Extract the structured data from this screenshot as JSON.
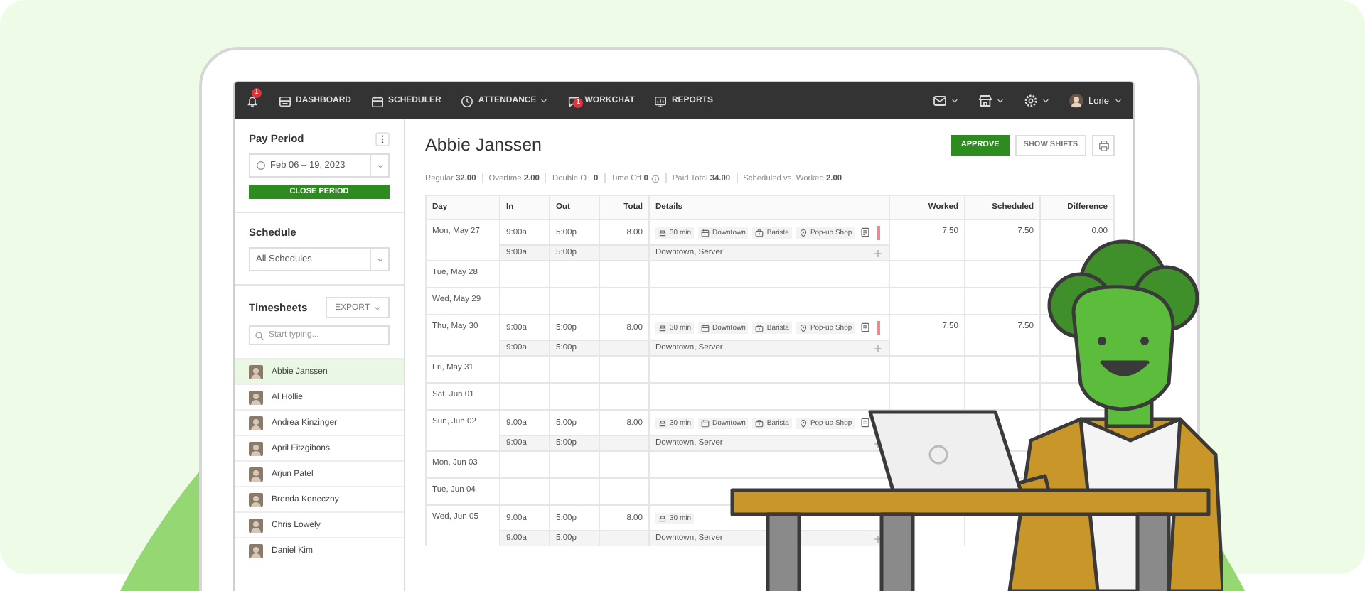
{
  "topbar": {
    "notifications_badge": "1",
    "items": [
      {
        "kind": "dashboard",
        "label": "DASHBOARD",
        "dropdown": false
      },
      {
        "kind": "scheduler",
        "label": "SCHEDULER",
        "dropdown": false
      },
      {
        "kind": "attendance",
        "label": "ATTENDANCE",
        "dropdown": true
      },
      {
        "kind": "workchat",
        "label": "WORKCHAT",
        "dropdown": false,
        "badge": "1"
      },
      {
        "kind": "reports",
        "label": "REPORTS",
        "dropdown": false
      }
    ],
    "menus": [
      {
        "kind": "mail"
      },
      {
        "kind": "store"
      },
      {
        "kind": "settings"
      }
    ],
    "user": {
      "name": "Lorie"
    }
  },
  "sidebar": {
    "pay_period": {
      "title": "Pay Period",
      "range": "Feb 06 – 19, 2023",
      "button": "CLOSE PERIOD"
    },
    "schedule": {
      "title": "Schedule",
      "value": "All Schedules"
    },
    "timesheets": {
      "title": "Timesheets",
      "export": "EXPORT",
      "search_placeholder": "Start typing..."
    },
    "employees": [
      {
        "name": "Abbie Janssen",
        "selected": true
      },
      {
        "name": "Al Hollie",
        "selected": false
      },
      {
        "name": "Andrea Kinzinger",
        "selected": false
      },
      {
        "name": "April Fitzgibons",
        "selected": false
      },
      {
        "name": "Arjun Patel",
        "selected": false
      },
      {
        "name": "Brenda Koneczny",
        "selected": false
      },
      {
        "name": "Chris Lowely",
        "selected": false
      },
      {
        "name": "Daniel Kim",
        "selected": false
      }
    ]
  },
  "main": {
    "title": "Abbie Janssen",
    "buttons": {
      "approve": "APPROVE",
      "show_shifts": "SHOW SHIFTS"
    },
    "summary": [
      {
        "label": "Regular",
        "value": "32.00",
        "info": false
      },
      {
        "label": "Overtime",
        "value": "2.00",
        "info": false
      },
      {
        "label": "Double OT",
        "value": "0",
        "info": false
      },
      {
        "label": "Time Off",
        "value": "0",
        "info": true
      },
      {
        "label": "Paid Total",
        "value": "34.00",
        "info": false
      },
      {
        "label": "Scheduled vs. Worked",
        "value": "2.00",
        "info": false
      }
    ],
    "table": {
      "columns": [
        "Day",
        "In",
        "Out",
        "Total",
        "Details",
        "Worked",
        "Scheduled",
        "Difference"
      ],
      "days": [
        {
          "day": "Mon, May 27",
          "shift": {
            "in": "9:00a",
            "out": "5:00p",
            "total": "8.00",
            "details": [
              {
                "kind": "break",
                "label": "30 min"
              },
              {
                "kind": "schedule",
                "label": "Downtown"
              },
              {
                "kind": "position",
                "label": "Barista"
              },
              {
                "kind": "site",
                "label": "Pop-up Shop"
              }
            ],
            "note": true,
            "flagged": true,
            "worked": "7.50",
            "scheduled": "7.50",
            "difference": "0.00",
            "sub": {
              "in": "9:00a",
              "out": "5:00p",
              "details": "Downtown, Server"
            }
          }
        },
        {
          "day": "Tue, May 28"
        },
        {
          "day": "Wed, May 29"
        },
        {
          "day": "Thu, May 30",
          "shift": {
            "in": "9:00a",
            "out": "5:00p",
            "total": "8.00",
            "details": [
              {
                "kind": "break",
                "label": "30 min"
              },
              {
                "kind": "schedule",
                "label": "Downtown"
              },
              {
                "kind": "position",
                "label": "Barista"
              },
              {
                "kind": "site",
                "label": "Pop-up Shop"
              }
            ],
            "note": true,
            "flagged": true,
            "worked": "7.50",
            "scheduled": "7.50",
            "sub": {
              "in": "9:00a",
              "out": "5:00p",
              "details": "Downtown, Server"
            }
          }
        },
        {
          "day": "Fri, May 31"
        },
        {
          "day": "Sat, Jun 01"
        },
        {
          "day": "Sun, Jun 02",
          "shift": {
            "in": "9:00a",
            "out": "5:00p",
            "total": "8.00",
            "details": [
              {
                "kind": "break",
                "label": "30 min"
              },
              {
                "kind": "schedule",
                "label": "Downtown"
              },
              {
                "kind": "position",
                "label": "Barista"
              },
              {
                "kind": "site",
                "label": "Pop-up Shop"
              }
            ],
            "note": true,
            "flagged": false,
            "sub": {
              "in": "9:00a",
              "out": "5:00p",
              "details": "Downtown, Server"
            }
          }
        },
        {
          "day": "Mon, Jun 03"
        },
        {
          "day": "Tue, Jun 04"
        },
        {
          "day": "Wed, Jun 05",
          "shift": {
            "in": "9:00a",
            "out": "5:00p",
            "total": "8.00",
            "details": [
              {
                "kind": "break",
                "label": "30 min"
              }
            ],
            "note": false,
            "flagged": false,
            "sub": {
              "in": "9:00a",
              "out": "5:00p",
              "details": "Downtown, Server"
            }
          }
        }
      ]
    }
  }
}
